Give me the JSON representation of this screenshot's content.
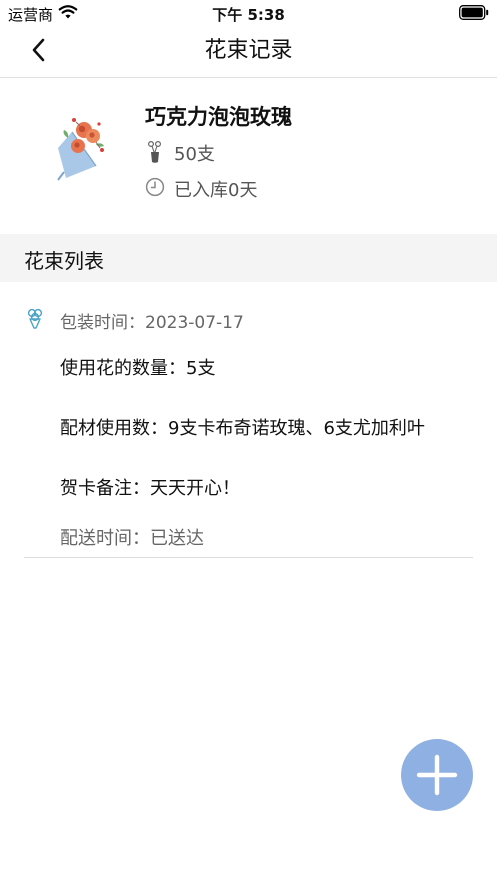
{
  "status_bar": {
    "carrier": "运营商",
    "time": "下午 5:38"
  },
  "nav": {
    "title": "花束记录",
    "back_icon": "chevron-left-icon"
  },
  "header": {
    "name": "巧克力泡泡玫瑰",
    "count": "50支",
    "stock": "已入库0天"
  },
  "section": {
    "title": "花束列表"
  },
  "record": {
    "pack_time": "包装时间：2023-07-17",
    "flower_count": "使用花的数量：5支",
    "materials": "配材使用数：9支卡布奇诺玫瑰、6支尤加利叶",
    "card_note": "贺卡备注：天天开心！",
    "delivery": "配送时间：已送达"
  },
  "fab": {
    "icon": "plus-icon",
    "color": "#8fb0e2"
  }
}
